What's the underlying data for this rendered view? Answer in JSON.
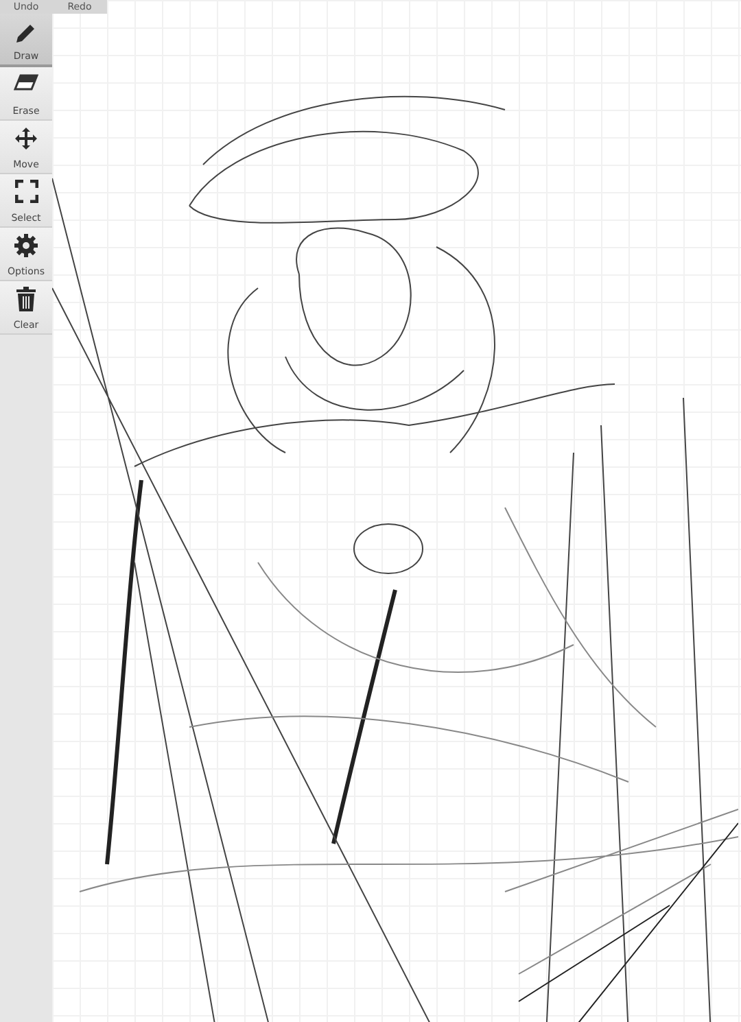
{
  "history_buttons": [
    {
      "label": "Undo"
    },
    {
      "label": "Redo"
    }
  ],
  "tools": [
    {
      "kind": "draw",
      "label": "Draw",
      "selected": true
    },
    {
      "kind": "erase",
      "label": "Erase",
      "selected": false
    },
    {
      "kind": "move",
      "label": "Move",
      "selected": false
    },
    {
      "kind": "select",
      "label": "Select",
      "selected": false
    },
    {
      "kind": "options",
      "label": "Options",
      "selected": false
    },
    {
      "kind": "clear",
      "label": "Clear",
      "selected": false
    }
  ]
}
